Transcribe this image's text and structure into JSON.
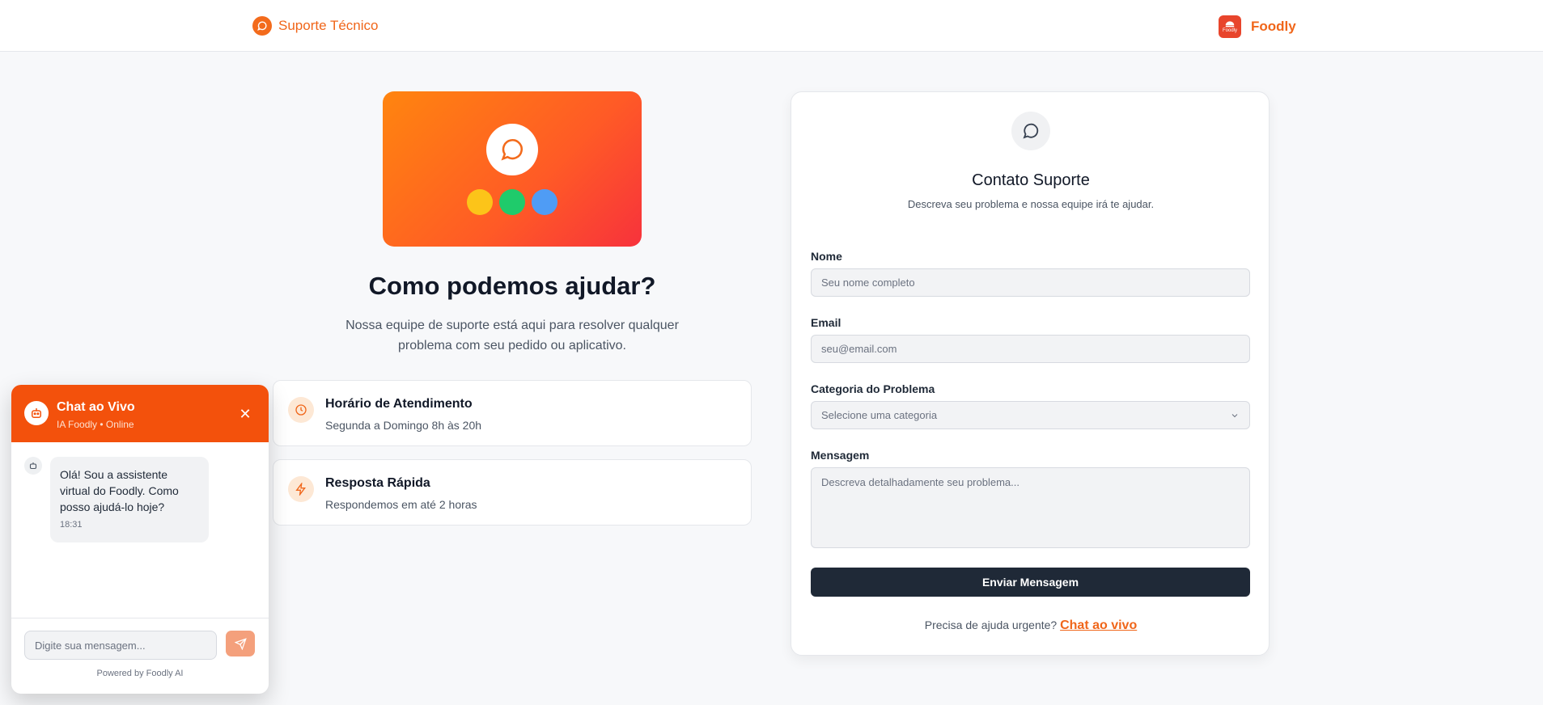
{
  "header": {
    "brand_left": "Suporte Técnico",
    "brand_right": "Foodly",
    "logo_small": "Foodly"
  },
  "hero": {
    "title": "Como podemos ajudar?",
    "subtitle": "Nossa equipe de suporte está aqui para resolver qualquer problema com seu pedido ou aplicativo.",
    "dot_colors": [
      "#fcc419",
      "#1fcb6b",
      "#4f9cf5"
    ]
  },
  "info_cards": [
    {
      "title": "Horário de Atendimento",
      "subtitle": "Segunda a Domingo 8h às 20h",
      "icon": "clock-icon"
    },
    {
      "title": "Resposta Rápida",
      "subtitle": "Respondemos em até 2 horas",
      "icon": "lightning-icon"
    }
  ],
  "form": {
    "title": "Contato Suporte",
    "subtitle": "Descreva seu problema e nossa equipe irá te ajudar.",
    "name_label": "Nome",
    "name_placeholder": "Seu nome completo",
    "email_label": "Email",
    "email_placeholder": "seu@email.com",
    "category_label": "Categoria do Problema",
    "category_value": "Selecione uma categoria",
    "message_label": "Mensagem",
    "message_placeholder": "Descreva detalhadamente seu problema...",
    "submit_label": "Enviar Mensagem",
    "urgent_text": "Precisa de ajuda urgente?",
    "urgent_link": "Chat ao vivo"
  },
  "chat": {
    "title": "Chat ao Vivo",
    "status": "IA Foodly • Online",
    "close": "✕",
    "message": "Olá! Sou a assistente virtual do Foodly. Como posso ajudá-lo hoje?",
    "message_time": "18:31",
    "input_placeholder": "Digite sua mensagem...",
    "powered_by": "Powered by Foodly AI"
  },
  "colors": {
    "accent": "#f0661a",
    "chat_header": "#f3510c",
    "submit_bg": "#1f2937"
  }
}
